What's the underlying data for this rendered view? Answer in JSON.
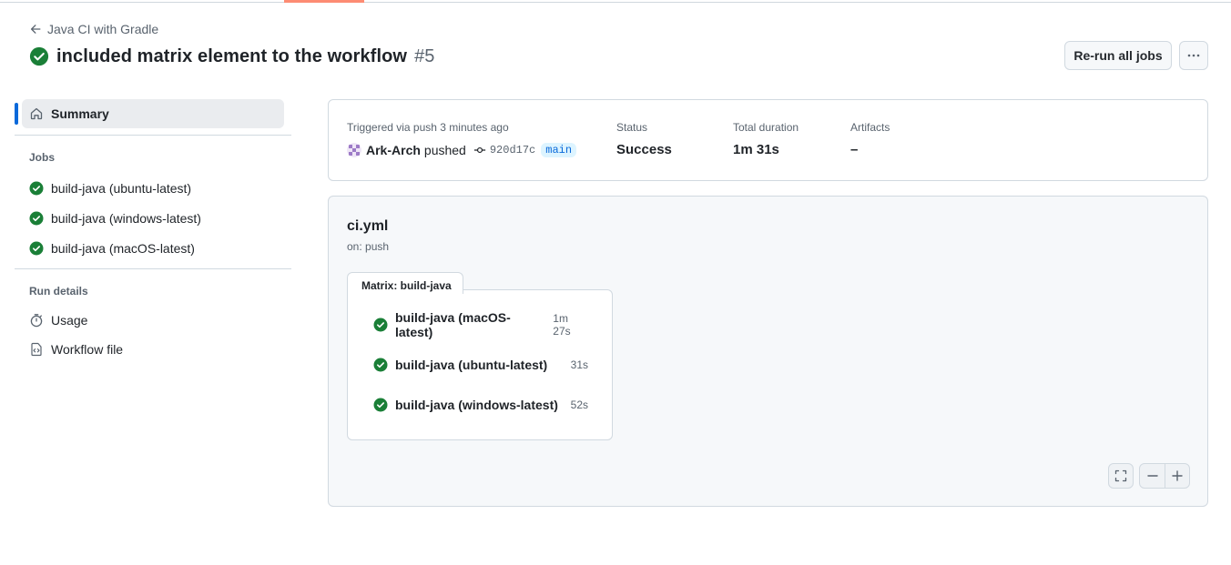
{
  "header": {
    "back_label": "Java CI with Gradle",
    "run_title": "included matrix element to the workflow",
    "run_number": "#5",
    "rerun_label": "Re-run all jobs",
    "more_label": "···"
  },
  "sidebar": {
    "summary_label": "Summary",
    "jobs_heading": "Jobs",
    "jobs": [
      {
        "label": "build-java (ubuntu-latest)",
        "status": "success"
      },
      {
        "label": "build-java (windows-latest)",
        "status": "success"
      },
      {
        "label": "build-java (macOS-latest)",
        "status": "success"
      }
    ],
    "run_details_heading": "Run details",
    "usage_label": "Usage",
    "workflow_file_label": "Workflow file"
  },
  "summary": {
    "trigger_text": "Triggered via push 3 minutes ago",
    "user": "Ark-Arch",
    "action": "pushed",
    "commit_sha": "920d17c",
    "branch": "main",
    "status_label": "Status",
    "status_value": "Success",
    "duration_label": "Total duration",
    "duration_value": "1m 31s",
    "artifacts_label": "Artifacts",
    "artifacts_value": "–"
  },
  "graph": {
    "workflow_file": "ci.yml",
    "trigger": "on: push",
    "matrix_label": "Matrix: build-java",
    "jobs": [
      {
        "name": "build-java (macOS-latest)",
        "duration": "1m 27s"
      },
      {
        "name": "build-java (ubuntu-latest)",
        "duration": "31s"
      },
      {
        "name": "build-java (windows-latest)",
        "duration": "52s"
      }
    ]
  },
  "colors": {
    "success": "#1a7f37",
    "accent": "#0969da",
    "tab_underline": "#fd8c73"
  }
}
